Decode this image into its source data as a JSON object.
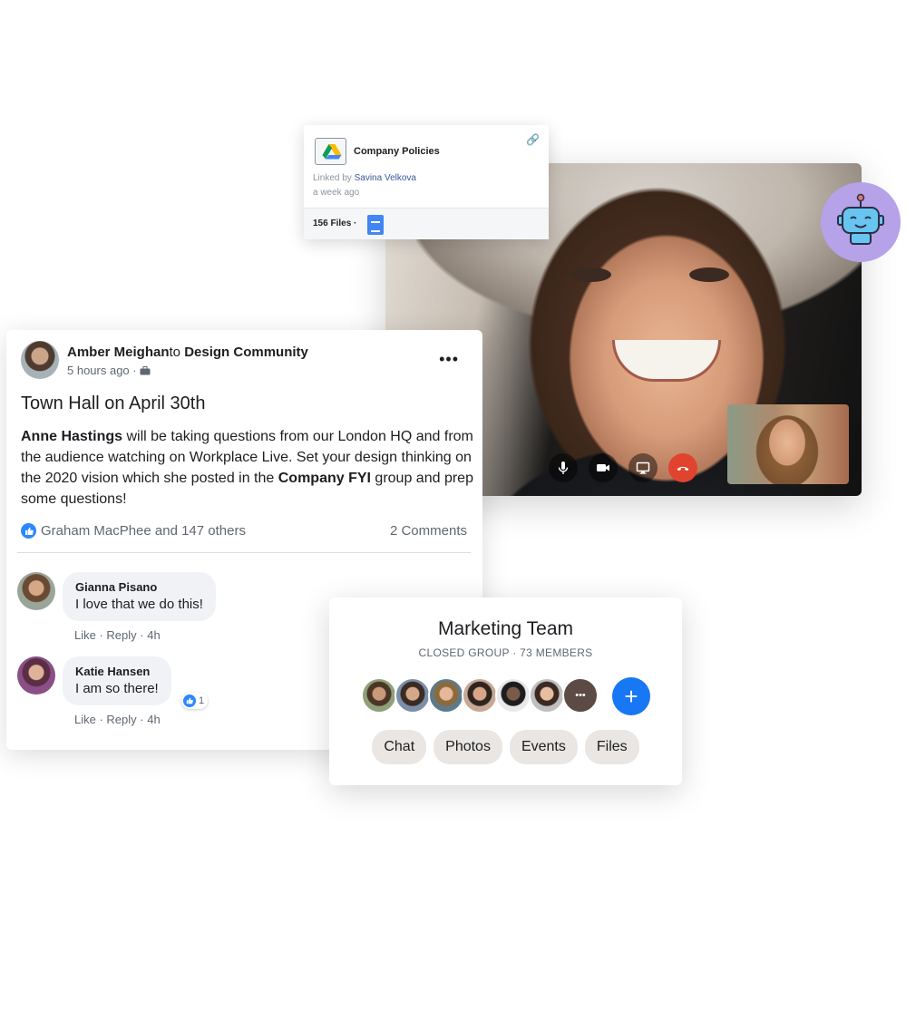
{
  "file_card": {
    "title": "Company Policies",
    "linked_prefix": "Linked by ",
    "linked_by": "Savina Velkova",
    "time": "a week ago",
    "files": "156 Files ·",
    "icons": [
      "google-drive-icon",
      "link-icon",
      "google-docs-icon"
    ]
  },
  "post": {
    "author": "Amber Meighan",
    "to": "to ",
    "group": "Design Community",
    "time": "5 hours ago ·",
    "more": "•••",
    "title": "Town Hall on April 30th",
    "body": {
      "p1_bold": "Anne Hastings",
      "p1": " will be taking questions from our London HQ and from the audience watching on Workplace Live. Set your design thinking on the 2020 vision which she posted in the ",
      "p2_bold": "Company FYI",
      "p2": " group and prep some questions!"
    },
    "reactions": "Graham MacPhee and 147 others",
    "comments_count": "2 Comments",
    "comments": [
      {
        "name": "Gianna Pisano",
        "text": "I love that we do this!",
        "like": "Like",
        "reply": "Reply",
        "time": "4h"
      },
      {
        "name": "Katie Hansen",
        "text": "I am so there!",
        "like": "Like",
        "reply": "Reply",
        "time": "4h",
        "reaction_count": "1"
      }
    ]
  },
  "group": {
    "title": "Marketing Team",
    "subtitle": "CLOSED GROUP · 73 MEMBERS",
    "more_members": "•••",
    "add": "+",
    "tabs": [
      "Chat",
      "Photos",
      "Events",
      "Files"
    ]
  },
  "colors": {
    "accent": "#1877f2",
    "end_call": "#e0442f",
    "bot_bg": "#b5a2e8",
    "link": "#385898"
  }
}
